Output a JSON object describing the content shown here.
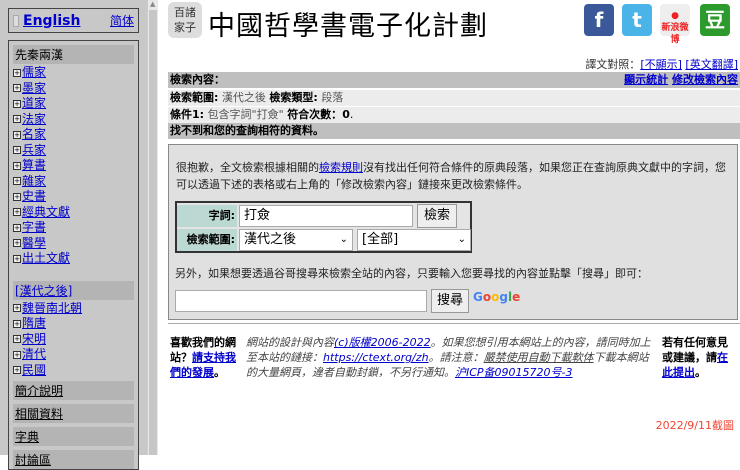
{
  "sidebar": {
    "english": "English",
    "simplified": "简体",
    "section1": "先秦兩漢",
    "items1": [
      "儒家",
      "墨家",
      "道家",
      "法家",
      "名家",
      "兵家",
      "算書",
      "雜家",
      "史書",
      "經典文獻",
      "字書",
      "醫學",
      "出土文獻"
    ],
    "section2": "[漢代之後]",
    "items2": [
      "魏晉南北朝",
      "隋唐",
      "宋明",
      "清代",
      "民國"
    ],
    "links": [
      "簡介說明",
      "相關資料",
      "字典",
      "討論區"
    ]
  },
  "header": {
    "logo": "百諸家子",
    "title": "中國哲學書電子化計劃",
    "social": [
      "facebook",
      "twitter",
      "weibo",
      "douban"
    ]
  },
  "translation": {
    "label": "譯文對照：",
    "hide": "[不顯示]",
    "english": "[英文翻譯]"
  },
  "results": {
    "content_label": "檢索內容：",
    "show_stats": "顯示統計",
    "modify": "修改檢索內容",
    "scope_label": "檢索範圍:",
    "scope_value": "漢代之後",
    "type_label": "檢索類型:",
    "type_value": "段落",
    "cond_label": "條件1:",
    "cond_value": "包含字詞\"打僉\"",
    "count_label": "符合次數：",
    "count_value": "0",
    "notfound": "找不到和您的查詢相符的資料。"
  },
  "panel": {
    "msg_a": "很抱歉，全文檢索根據相關的",
    "msg_link": "檢索規則",
    "msg_b": "沒有找出任何符合條件的原典段落，如果您正在查詢原典文獻中的字詞，您可以透過下述的表格或右上角的「修改檢索內容」鏈接來更改檢索條件。",
    "word_label": "字詞:",
    "word_value": "打僉",
    "search_btn": "檢索",
    "scope_label": "檢索範圍:",
    "scope_select": "漢代之後",
    "sub_select": "[全部]",
    "other": "另外，如果想要透過谷哥搜尋來檢索全站的內容，只要輸入您要尋找的內容並點擊「搜尋」即可：",
    "google_btn": "搜尋",
    "google": "Google"
  },
  "footer": {
    "left_a": "喜歡我們的網站？",
    "left_link": "請支持我們的發展",
    "left_b": "。",
    "mid_a": "網站的設計與內容",
    "mid_link1": "(c)版權2006-2022",
    "mid_b": "。如果您想引用本網站上的內容，請同時加上至本站的鏈接：",
    "mid_link2": "https://ctext.org/zh",
    "mid_c": "。請注意：",
    "mid_u": "嚴禁使用自動下載軟体",
    "mid_d": "下載本網站的大量網頁，違者自動封鎖，不另行通知。",
    "mid_link3": "沪ICP备09015720号-3",
    "right_a": "若有任何意見或建議，請",
    "right_link": "在此提出",
    "right_b": "。",
    "date": "2022/9/11截圖"
  }
}
